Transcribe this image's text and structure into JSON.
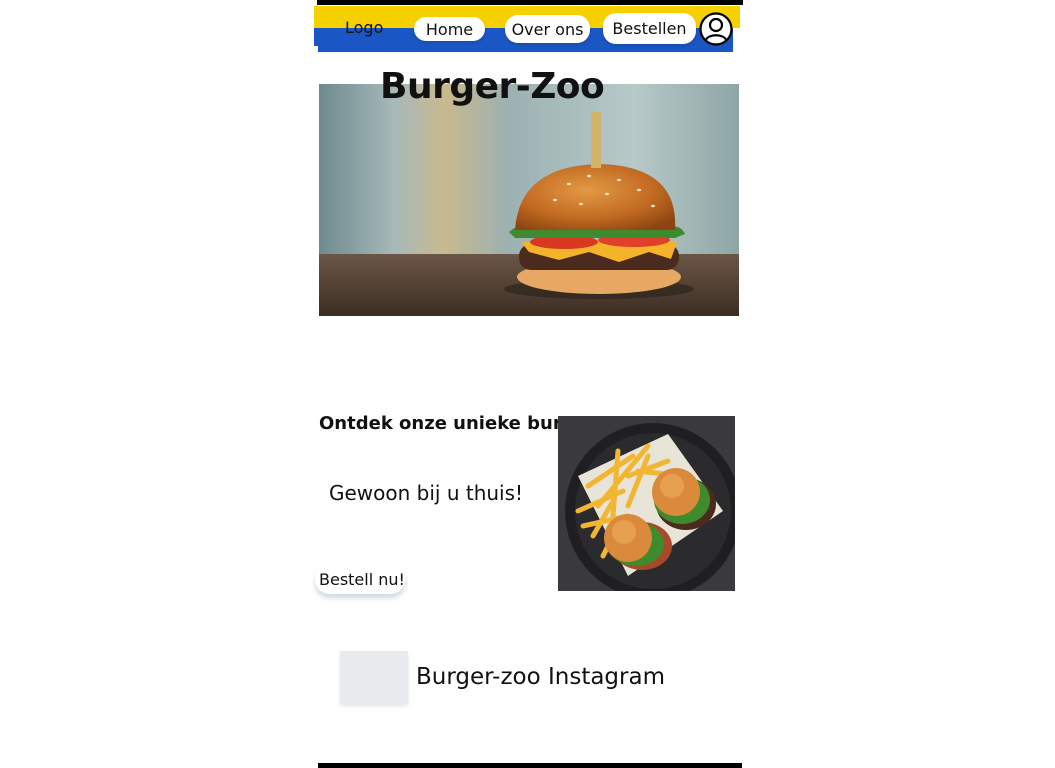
{
  "nav": {
    "logo": "Logo",
    "items": [
      {
        "label": "Home"
      },
      {
        "label": "Over ons"
      },
      {
        "label": "Bestellen"
      }
    ],
    "account_icon": "user-icon",
    "colors": {
      "yellow": "#f7d000",
      "blue": "#1a56c4"
    }
  },
  "hero": {
    "title": "Burger-Zoo",
    "image": "burger-photo"
  },
  "promo": {
    "heading": "Ontdek onze unieke burgers!",
    "subtitle": "Gewoon bij u thuis!",
    "button": "Bestell nu!",
    "image": "burgers-and-fries-photo"
  },
  "instagram": {
    "label": "Burger-zoo Instagram",
    "thumbnail": "instagram-thumbnail"
  }
}
